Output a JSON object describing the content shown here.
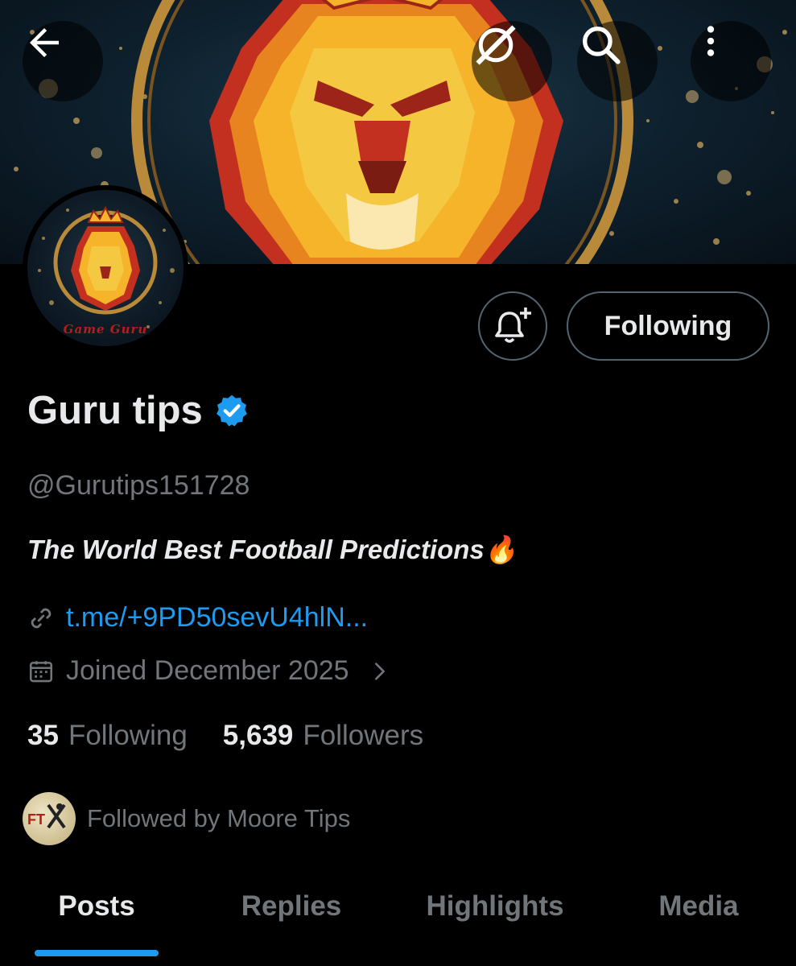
{
  "header": {
    "back_icon": "arrow-left-icon",
    "grok_icon": "grok-icon",
    "search_icon": "search-icon",
    "more_icon": "more-vertical-icon"
  },
  "avatar": {
    "caption": "Game Guru"
  },
  "actions": {
    "notify_icon": "bell-plus-icon",
    "following_label": "Following"
  },
  "profile": {
    "display_name": "Guru tips",
    "verified": true,
    "handle": "@Gurutips151728",
    "bio": "The World Best Football Predictions🔥",
    "link": "t.me/+9PD50sevU4hlN...",
    "joined": "Joined December 2025",
    "following_count": "35",
    "following_label": "Following",
    "followers_count": "5,639",
    "followers_label": "Followers",
    "followed_by": "Followed by Moore Tips"
  },
  "tabs": [
    {
      "label": "Posts",
      "active": true
    },
    {
      "label": "Replies",
      "active": false
    },
    {
      "label": "Highlights",
      "active": false
    },
    {
      "label": "Media",
      "active": false
    }
  ],
  "colors": {
    "background": "#000000",
    "text_primary": "#e7e9ea",
    "text_secondary": "#71767b",
    "accent": "#1d9bf0",
    "border": "#536471"
  }
}
